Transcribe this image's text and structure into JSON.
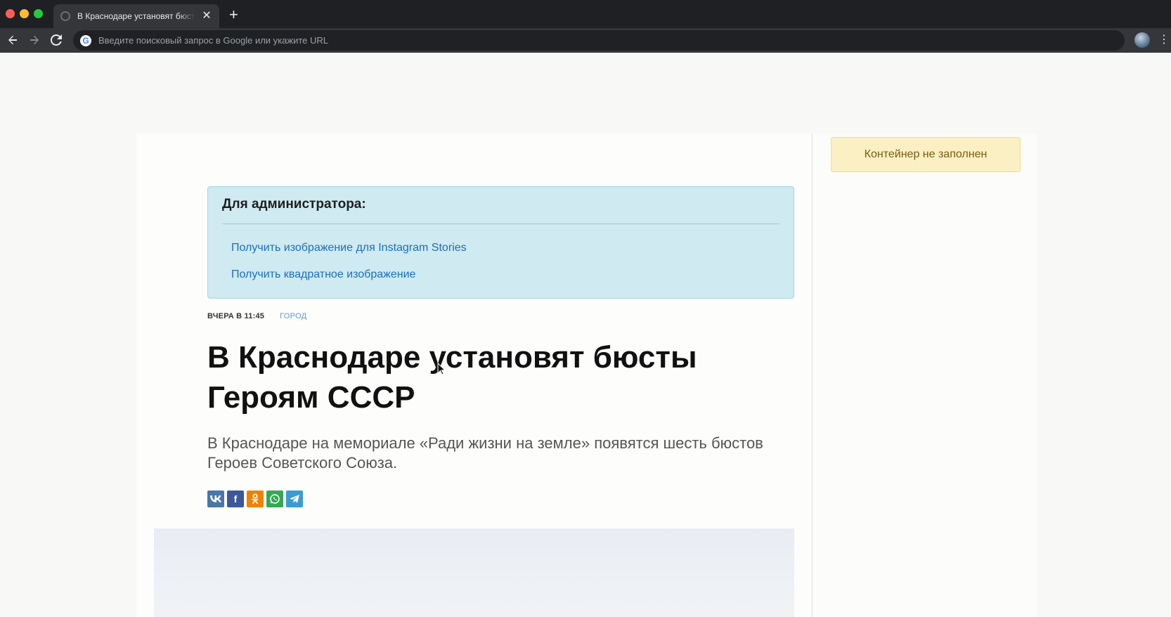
{
  "browser": {
    "tab_title": "В Краснодаре установят бюсты Героям СССР",
    "tab_close": "✕",
    "new_tab": "+",
    "omnibox_placeholder": "Введите поисковый запрос в Google или укажите URL",
    "google_glyph": "G",
    "icons": {
      "back": "back-arrow-icon",
      "forward": "forward-arrow-icon",
      "reload": "reload-icon",
      "menu": "kebab-menu-icon"
    }
  },
  "sidebar": {
    "banner_text": "Контейнер не заполнен"
  },
  "admin": {
    "title": "Для администратора:",
    "links": [
      "Получить изображение для Instagram Stories",
      "Получить квадратное изображение"
    ]
  },
  "article": {
    "date": "ВЧЕРА В 11:45",
    "category": "ГОРОД",
    "headline": "В Краснодаре установят бюсты Героям СССР",
    "lead": "В Краснодаре на мемориале «Ради жизни на земле» появятся шесть бюстов Героев Советского Союза.",
    "share": [
      {
        "id": "vk",
        "glyph": "vk",
        "color": "#4a76a8"
      },
      {
        "id": "fb",
        "glyph": "f",
        "color": "#3b5998"
      },
      {
        "id": "ok",
        "glyph": "ok",
        "color": "#ee8208"
      },
      {
        "id": "wa",
        "glyph": "wa",
        "color": "#34a853"
      },
      {
        "id": "tg",
        "glyph": "tg",
        "color": "#3a9bd3"
      }
    ]
  },
  "colors": {
    "admin_bg": "#cfeaf0",
    "link": "#1a6fbf",
    "banner_bg": "#fbf0c4"
  }
}
